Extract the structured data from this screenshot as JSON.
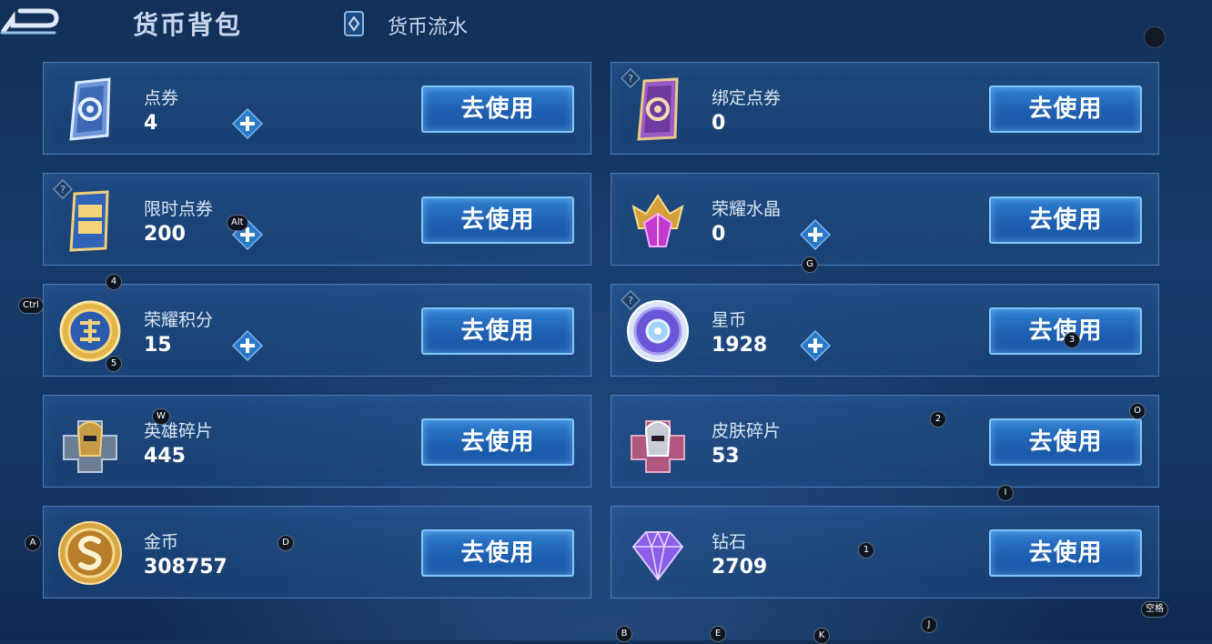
{
  "header": {
    "title": "货币背包",
    "flow_label": "货币流水"
  },
  "use_label": "去使用",
  "cards": [
    {
      "name": "点券",
      "amount": "4"
    },
    {
      "name": "绑定点券",
      "amount": "0"
    },
    {
      "name": "限时点券",
      "amount": "200"
    },
    {
      "name": "荣耀水晶",
      "amount": "0"
    },
    {
      "name": "荣耀积分",
      "amount": "15"
    },
    {
      "name": "星币",
      "amount": "1928"
    },
    {
      "name": "英雄碎片",
      "amount": "445"
    },
    {
      "name": "皮肤碎片",
      "amount": "53"
    },
    {
      "name": "金币",
      "amount": "308757"
    },
    {
      "name": "钻石",
      "amount": "2709"
    }
  ],
  "icons": {
    "coupon": "coupon-card-icon",
    "bound_coupon": "bound-coupon-card-icon",
    "limited_coupon": "limited-coupon-icon",
    "glory_crystal": "crystal-crown-icon",
    "glory_points": "glory-points-medal-icon",
    "star_coin": "star-coin-icon",
    "hero_fragment": "hero-fragment-icon",
    "skin_fragment": "skin-fragment-icon",
    "gold": "gold-coin-icon",
    "diamond": "diamond-icon"
  },
  "hints": {
    "alt": "Alt",
    "ctrl": "Ctrl",
    "k4": "4",
    "k5": "5",
    "w": "W",
    "g": "G",
    "k3": "3",
    "k2": "2",
    "o": "O",
    "i": "I",
    "a": "A",
    "d": "D",
    "k1": "1",
    "space": "空格",
    "b": "B",
    "e": "E",
    "k": "K",
    "j": "J"
  },
  "colors": {
    "button_blue": "#1e5fb0",
    "button_border": "#7ec6ff",
    "card_border": "#4d7cb8",
    "plus_blue": "#2a78c8"
  }
}
